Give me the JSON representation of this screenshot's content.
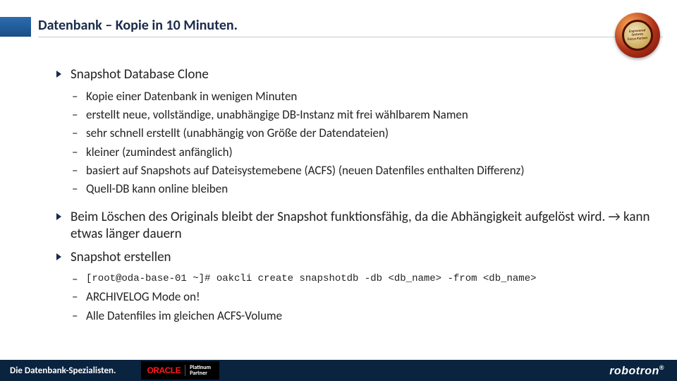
{
  "title": "Datenbank – Kopie in 10 Minuten.",
  "badge": {
    "line1": "Engineered Systems",
    "line2": "Focus Partner"
  },
  "bullets": {
    "b1": {
      "label": "Snapshot Database Clone",
      "subs": {
        "s0": "Kopie einer Datenbank in wenigen Minuten",
        "s1": "erstellt neue, vollständige, unabhängige DB-Instanz mit frei wählbarem Namen",
        "s2": "sehr schnell erstellt (unabhängig von Größe der Datendateien)",
        "s3": "kleiner (zumindest anfänglich)",
        "s4": "basiert auf Snapshots auf Dateisystemebene (ACFS) (neuen Datenfiles enthalten Differenz)",
        "s5": "Quell-DB kann online bleiben"
      }
    },
    "b2": {
      "label": "Beim Löschen des Originals bleibt der Snapshot funktionsfähig, da die Abhängigkeit aufgelöst wird. → kann etwas länger dauern"
    },
    "b3": {
      "label": "Snapshot erstellen",
      "subs": {
        "cmd": "[root@oda-base-01 ~]# oakcli create snapshotdb  -db <db_name> -from <db_name>",
        "s1": "ARCHIVELOG Mode on!",
        "s2": "Alle Datenfiles im gleichen ACFS-Volume"
      }
    }
  },
  "footer": {
    "left": "Die Datenbank-Spezialisten.",
    "oracle": "ORACLE",
    "partner1": "Platinum",
    "partner2": "Partner",
    "right": "robotron"
  },
  "dash": "–"
}
